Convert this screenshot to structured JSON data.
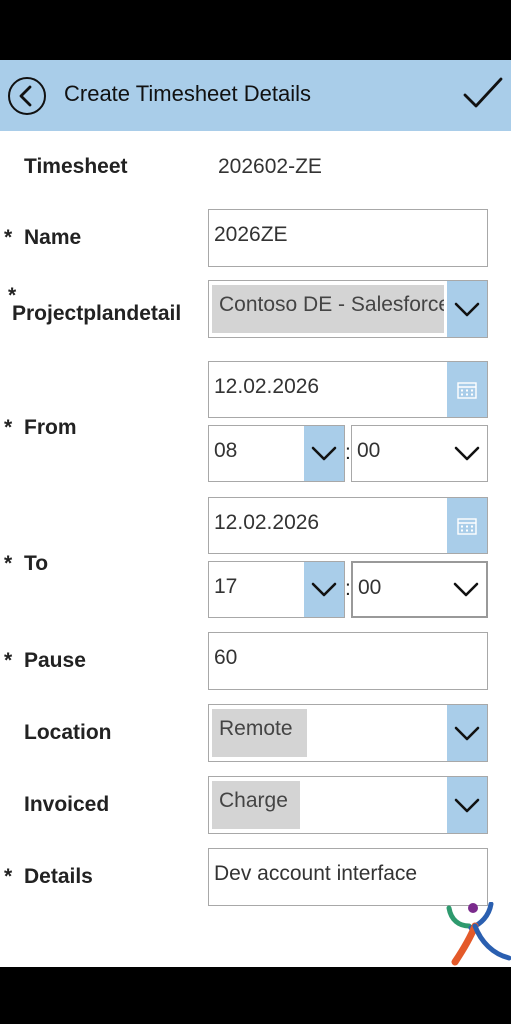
{
  "header": {
    "title": "Create Timesheet Details"
  },
  "form": {
    "timesheet": {
      "label": "Timesheet",
      "value": "202602-ZE"
    },
    "name": {
      "required": "*",
      "label": "Name",
      "value": "2026ZE"
    },
    "projectplandetail": {
      "required": "*",
      "label": "Projectplandetail",
      "value": "Contoso DE - Salesforce"
    },
    "from": {
      "required": "*",
      "label": "From",
      "date": "12.02.2026",
      "hour": "08",
      "minute": "00"
    },
    "to": {
      "required": "*",
      "label": "To",
      "date": "12.02.2026",
      "hour": "17",
      "minute": "00"
    },
    "pause": {
      "required": "*",
      "label": "Pause",
      "value": "60"
    },
    "location": {
      "label": "Location",
      "value": "Remote"
    },
    "invoiced": {
      "label": "Invoiced",
      "value": "Charge"
    },
    "details": {
      "required": "*",
      "label": "Details",
      "value": "Dev account interface"
    },
    "time_separator": ":"
  },
  "colors": {
    "header": "#a9cde9",
    "accent": "#a9cde9",
    "chip": "#d4d4d4"
  },
  "icons": [
    "back-arrow-icon",
    "checkmark-icon",
    "calendar-icon",
    "chevron-down-icon",
    "logo"
  ]
}
